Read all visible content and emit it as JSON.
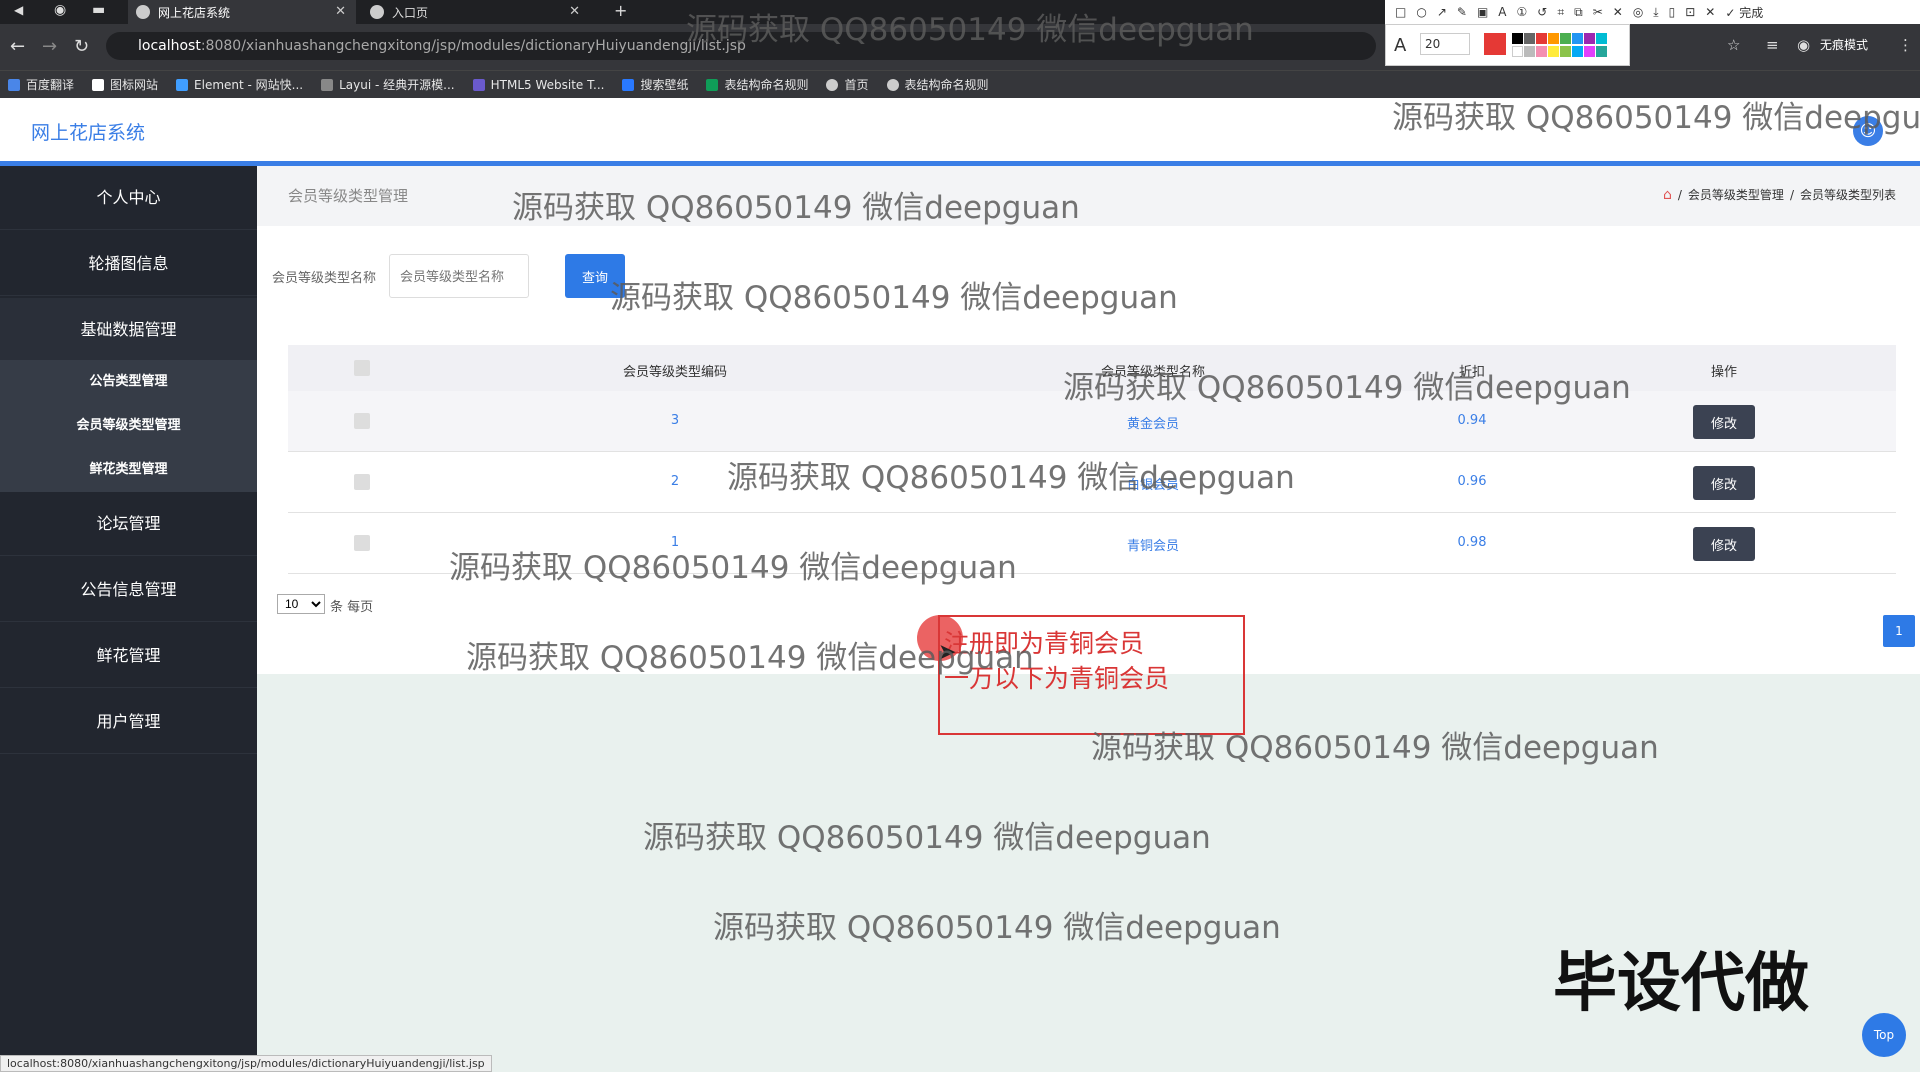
{
  "browser": {
    "tabs": [
      {
        "title": "网上花店系统"
      },
      {
        "title": "入口页"
      }
    ],
    "url_host": "localhost",
    "url_path": ":8080/xianhuashangchengxitong/jsp/modules/dictionaryHuiyuandengji/list.jsp",
    "bookmarks": [
      "百度翻译",
      "图标网站",
      "Element - 网站快...",
      "Layui - 经典开源模...",
      "HTML5 Website T...",
      "搜索壁纸",
      "表结构命名规则",
      "首页",
      "表结构命名规则"
    ],
    "annot_font_size": "20",
    "annot_done": "完成",
    "incognito_label": "无痕模式",
    "status_url": "localhost:8080/xianhuashangchengxitong/jsp/modules/dictionaryHuiyuandengji/list.jsp"
  },
  "app": {
    "title": "网上花店系统",
    "avatar_icon": "user-icon"
  },
  "sidebar": {
    "items": [
      {
        "label": "个人中心"
      },
      {
        "label": "轮播图信息"
      },
      {
        "label": "基础数据管理"
      },
      {
        "label": "论坛管理"
      },
      {
        "label": "公告信息管理"
      },
      {
        "label": "鲜花管理"
      },
      {
        "label": "用户管理"
      }
    ],
    "subitems": [
      {
        "label": "公告类型管理"
      },
      {
        "label": "会员等级类型管理"
      },
      {
        "label": "鲜花类型管理"
      }
    ]
  },
  "page": {
    "heading": "会员等级类型管理",
    "breadcrumb": [
      "会员等级类型管理",
      "会员等级类型列表"
    ]
  },
  "search": {
    "label": "会员等级类型名称",
    "placeholder": "会员等级类型名称",
    "button": "查询"
  },
  "table": {
    "columns": [
      "会员等级类型编码",
      "会员等级类型名称",
      "折扣",
      "操作"
    ],
    "rows": [
      {
        "code": "3",
        "name": "黄金会员",
        "discount": "0.94",
        "action": "修改"
      },
      {
        "code": "2",
        "name": "白银会员",
        "discount": "0.96",
        "action": "修改"
      },
      {
        "code": "1",
        "name": "青铜会员",
        "discount": "0.98",
        "action": "修改"
      }
    ]
  },
  "pager": {
    "page_size": "10",
    "per_page_label": "条 每页",
    "current_page": "1"
  },
  "annotation": {
    "line1": "注册即为青铜会员",
    "line2": "一万以下为青铜会员"
  },
  "watermark_text": "源码获取 QQ86050149 微信deepguan",
  "overlay_text": "毕设代做",
  "top_button": "Top",
  "colors": {
    "primary": "#2e7ae6",
    "sidebar": "#22262f",
    "annotation": "#d93636"
  }
}
